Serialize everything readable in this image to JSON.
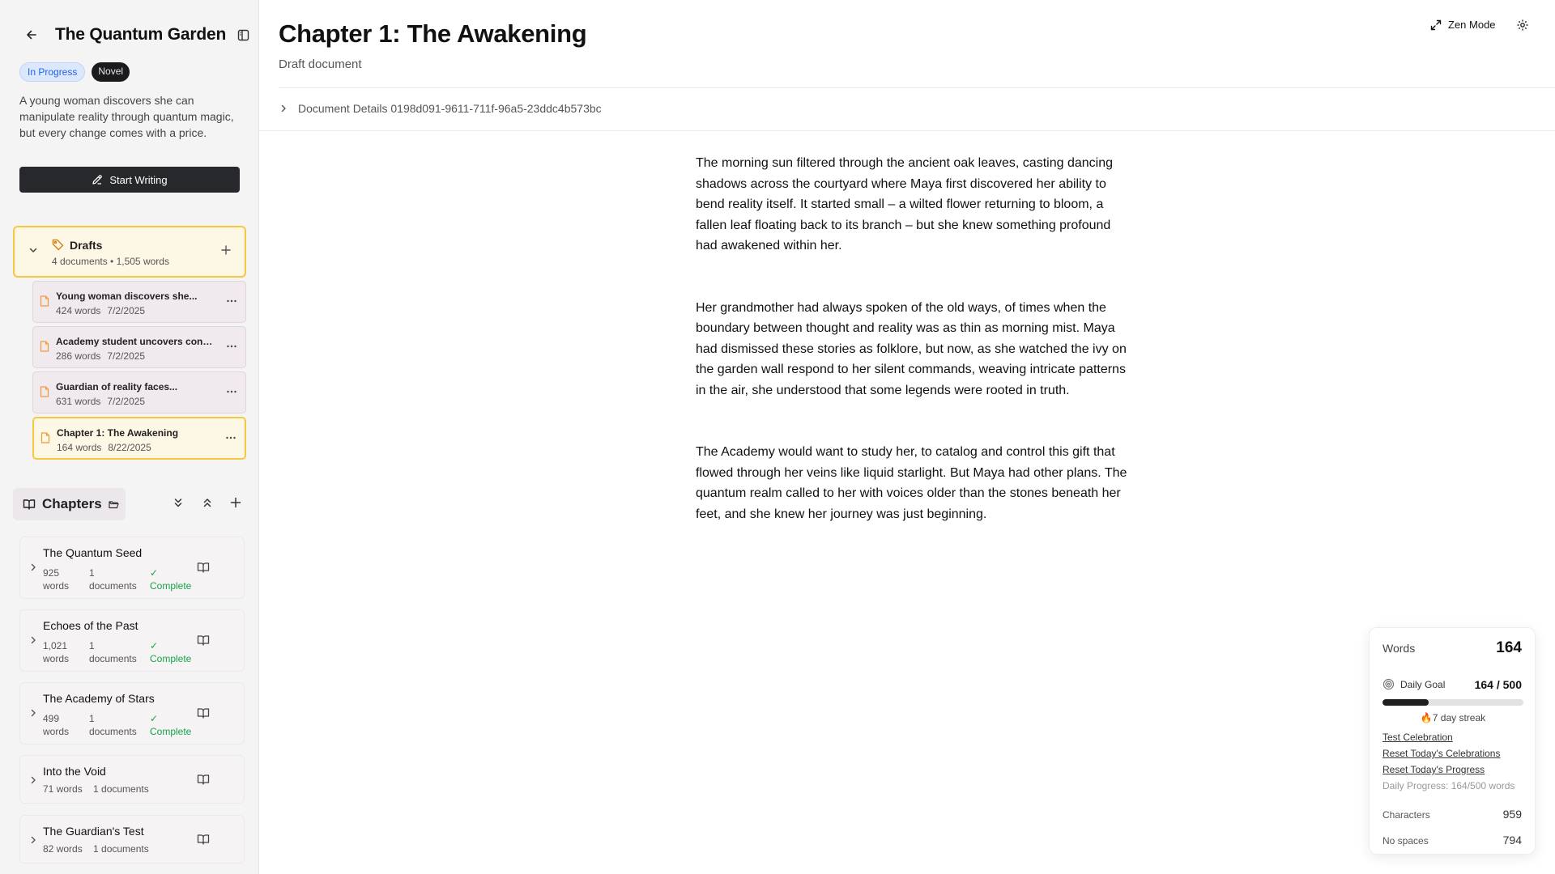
{
  "project": {
    "title": "The Quantum Garden",
    "status_badge": "In Progress",
    "type_badge": "Novel",
    "description": "A young woman discovers she can manipulate reality through quantum magic, but every change comes with a price.",
    "start_writing_label": "Start Writing"
  },
  "drafts": {
    "title": "Drafts",
    "subtitle": "4 documents • 1,505 words",
    "items": [
      {
        "title": "Young woman discovers she...",
        "words": "424 words",
        "date": "7/2/2025"
      },
      {
        "title": "Academy student uncovers consp...",
        "words": "286 words",
        "date": "7/2/2025"
      },
      {
        "title": "Guardian of reality faces...",
        "words": "631 words",
        "date": "7/2/2025"
      },
      {
        "title": "Chapter 1: The Awakening",
        "words": "164 words",
        "date": "8/22/2025"
      }
    ]
  },
  "chapters": {
    "label": "Chapters",
    "items": [
      {
        "title": "The Quantum Seed",
        "words_num": "925",
        "words_unit": "words",
        "docs_num": "1",
        "docs_unit": "documents",
        "status_check": "✓",
        "status": "Complete"
      },
      {
        "title": "Echoes of the Past",
        "words_num": "1,021",
        "words_unit": "words",
        "docs_num": "1",
        "docs_unit": "documents",
        "status_check": "✓",
        "status": "Complete"
      },
      {
        "title": "The Academy of Stars",
        "words_num": "499",
        "words_unit": "words",
        "docs_num": "1",
        "docs_unit": "documents",
        "status_check": "✓",
        "status": "Complete"
      },
      {
        "title": "Into the Void",
        "meta": "71 words    1 documents"
      },
      {
        "title": "The Guardian's Test",
        "meta": "82 words    1 documents"
      }
    ]
  },
  "editor": {
    "title": "Chapter 1: The Awakening",
    "subtitle": "Draft document",
    "zen_label": "Zen Mode",
    "details_label": "Document Details 0198d091-9611-711f-96a5-23ddc4b573bc",
    "paragraphs": [
      "The morning sun filtered through the ancient oak leaves, casting dancing shadows across the courtyard where Maya first discovered her ability to bend reality itself. It started small – a wilted flower returning to bloom, a fallen leaf floating back to its branch – but she knew something profound had awakened within her.",
      "Her grandmother had always spoken of the old ways, of times when the boundary between thought and reality was as thin as morning mist. Maya had dismissed these stories as folklore, but now, as she watched the ivy on the garden wall respond to her silent commands, weaving intricate patterns in the air, she understood that some legends were rooted in truth.",
      "The Academy would want to study her, to catalog and control this gift that flowed through her veins like liquid starlight. But Maya had other plans. The quantum realm called to her with voices older than the stones beneath her feet, and she knew her journey was just beginning."
    ]
  },
  "stats": {
    "words_label": "Words",
    "words_value": "164",
    "goal_label": "Daily Goal",
    "goal_value": "164 / 500",
    "goal_fraction": 0.328,
    "streak": "🔥7 day streak",
    "links": [
      "Test Celebration",
      "Reset Today's Celebrations",
      "Reset Today's Progress"
    ],
    "progress_note": "Daily Progress: 164/500 words",
    "characters_label": "Characters",
    "characters_value": "959",
    "nospaces_label": "No spaces",
    "nospaces_value": "794"
  },
  "colors": {
    "accent_yellow": "#f5c842",
    "complete_green": "#16a34a",
    "status_blue": "#2563eb"
  }
}
